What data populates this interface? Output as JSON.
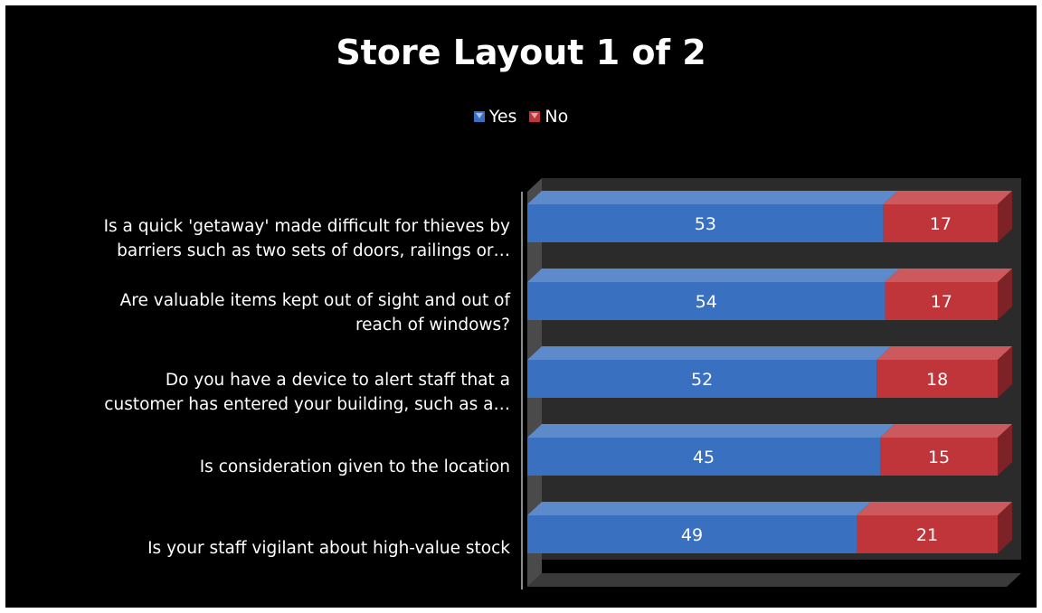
{
  "chart_data": {
    "type": "bar",
    "orientation": "horizontal",
    "stacked": true,
    "style": "3d",
    "title": "Store Layout 1 of 2",
    "legend_position": "top",
    "categories": [
      "Is a quick 'getaway' made difficult for thieves by\nbarriers such as two sets of doors, railings or…",
      "Are valuable items kept out of sight and out of\nreach of windows?",
      "Do you have a device to alert staff that a\ncustomer has entered your building, such as a…",
      "Is consideration given to the location",
      "Is your staff vigilant about high-value stock"
    ],
    "series": [
      {
        "name": "Yes",
        "color": "#3a70c0",
        "values": [
          53,
          54,
          52,
          45,
          49
        ]
      },
      {
        "name": "No",
        "color": "#c0353a",
        "values": [
          17,
          17,
          18,
          15,
          21
        ]
      }
    ],
    "data_labels": true,
    "grid": false,
    "background": "#000000"
  }
}
